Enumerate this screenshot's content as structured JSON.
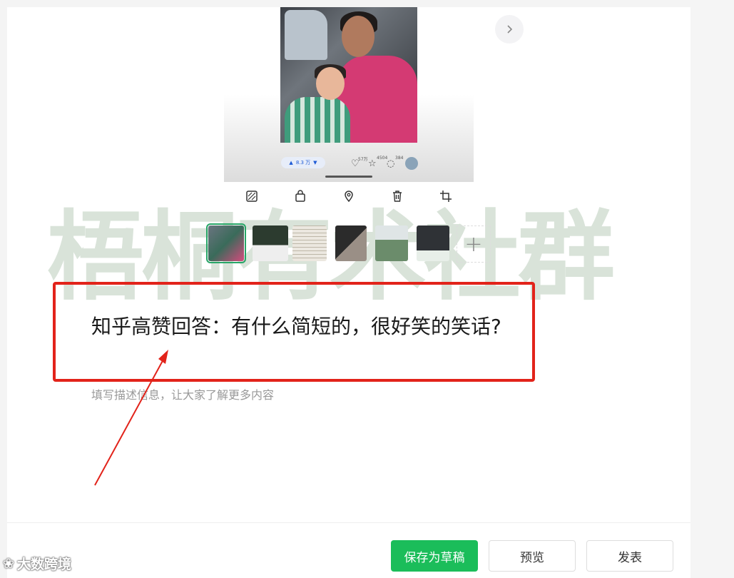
{
  "preview": {
    "vote_count": "8.3 万",
    "like_count": "57万",
    "fav_count": "4504",
    "comment_count": "384"
  },
  "watermark": "梧桐有术社群",
  "post": {
    "title": "知乎高赞回答：有什么简短的，很好笑的笑话?",
    "description_placeholder": "填写描述信息，让大家了解更多内容"
  },
  "actions": {
    "save_draft": "保存为草稿",
    "preview": "预览",
    "publish": "发表"
  },
  "corner_watermark": "大数跨境",
  "colors": {
    "accent": "#1bbd5a",
    "annotation": "#e2231a"
  }
}
